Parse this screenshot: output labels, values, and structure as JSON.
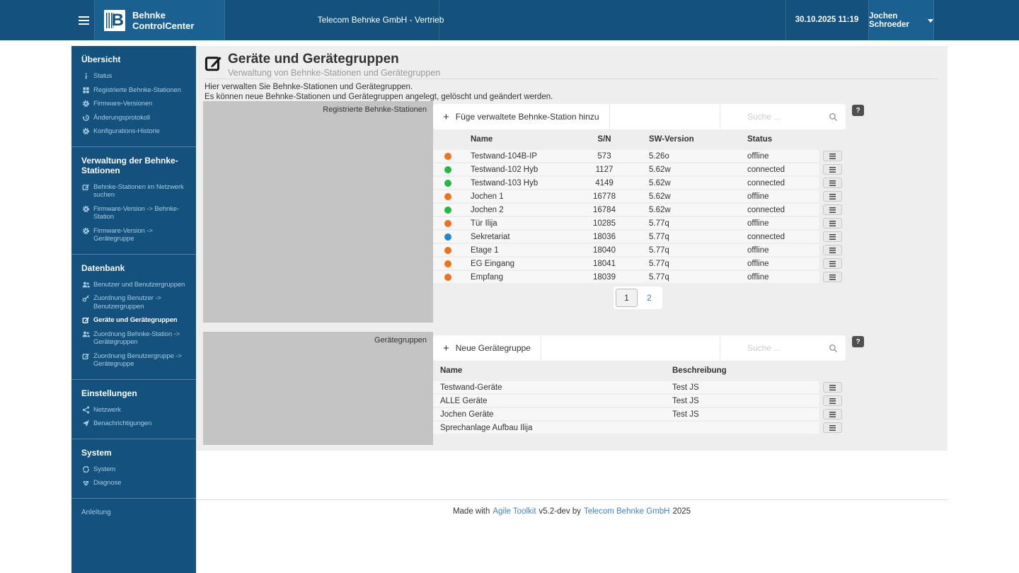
{
  "header": {
    "brand": "Behnke ControlCenter",
    "tenant": "Telecom Behnke GmbH - Vertrieb",
    "datetime": "30.10.2025 11:19",
    "user": "Jochen Schroeder"
  },
  "sidebar": {
    "sections": [
      {
        "title": "Übersicht",
        "items": [
          {
            "icon": "info-icon",
            "label": "Status"
          },
          {
            "icon": "stations-icon",
            "label": "Registrierte Behnke-Stationen"
          },
          {
            "icon": "gear-icon",
            "label": "Firmware-Versionen"
          },
          {
            "icon": "history-icon",
            "label": "Änderungsprotokoll"
          },
          {
            "icon": "gear-icon",
            "label": "Konfigurations-Historie"
          }
        ]
      },
      {
        "title": "Verwaltung der Behnke-Stationen",
        "items": [
          {
            "icon": "edit-icon",
            "label": "Behnke-Stationen im Netzwerk suchen"
          },
          {
            "icon": "gear-icon",
            "label": "Firmware-Version -> Behnke-Station"
          },
          {
            "icon": "gear-icon",
            "label": "Firmware-Version -> Gerätegruppe"
          }
        ]
      },
      {
        "title": "Datenbank",
        "items": [
          {
            "icon": "users-icon",
            "label": "Benutzer und Benutzergruppen"
          },
          {
            "icon": "key-icon",
            "label": "Zuordnung Benutzer -> Benutzergruppen"
          },
          {
            "icon": "edit-icon",
            "label": "Geräte und Gerätegruppen",
            "active": true
          },
          {
            "icon": "users-icon",
            "label": "Zuordnung Behnke-Station -> Gerätegruppen"
          },
          {
            "icon": "edit-icon",
            "label": "Zuordnung Benutzergruppe -> Gerätegruppe"
          }
        ]
      },
      {
        "title": "Einstellungen",
        "items": [
          {
            "icon": "share-icon",
            "label": "Netzwerk"
          },
          {
            "icon": "send-icon",
            "label": "Benachrichtigungen"
          }
        ]
      },
      {
        "title": "System",
        "items": [
          {
            "icon": "sync-icon",
            "label": "System"
          },
          {
            "icon": "heartbeat-icon",
            "label": "Diagnose"
          }
        ]
      }
    ],
    "footer_link": "Anleitung"
  },
  "page": {
    "title": "Geräte und Gerätegruppen",
    "subtitle": "Verwaltung von Behnke-Stationen und Gerätegruppen",
    "description_lines": [
      "Hier verwalten Sie Behnke-Stationen und Gerätegruppen.",
      "Es können neue Behnke-Stationen und Gerätegruppen angelegt, gelöscht und geändert werden."
    ]
  },
  "stations": {
    "image_label": "Registrierte Behnke-Stationen",
    "add_button": "Füge verwaltete Behnke-Station hinzu",
    "search_placeholder": "Suche ...",
    "help_label": "?",
    "columns": [
      "Name",
      "S/N",
      "SW-Version",
      "Status"
    ],
    "rows": [
      {
        "dot": "orange",
        "name": "Testwand-104B-IP",
        "sn": "573",
        "sw": "5.26o",
        "status": "offline"
      },
      {
        "dot": "green",
        "name": "Testwand-102 Hyb",
        "sn": "1127",
        "sw": "5.62w",
        "status": "connected"
      },
      {
        "dot": "green",
        "name": "Testwand-103 Hyb",
        "sn": "4149",
        "sw": "5.62w",
        "status": "connected"
      },
      {
        "dot": "orange",
        "name": "Jochen 1",
        "sn": "16778",
        "sw": "5.62w",
        "status": "offline"
      },
      {
        "dot": "green",
        "name": "Jochen 2",
        "sn": "16784",
        "sw": "5.62w",
        "status": "connected"
      },
      {
        "dot": "orange",
        "name": "Tür Ilija",
        "sn": "10285",
        "sw": "5.77q",
        "status": "offline"
      },
      {
        "dot": "blue",
        "name": "Sekretariat",
        "sn": "18036",
        "sw": "5.77q",
        "status": "connected"
      },
      {
        "dot": "orange",
        "name": "Etage 1",
        "sn": "18040",
        "sw": "5.77q",
        "status": "offline"
      },
      {
        "dot": "orange",
        "name": "EG Eingang",
        "sn": "18041",
        "sw": "5.77q",
        "status": "offline"
      },
      {
        "dot": "orange",
        "name": "Empfang",
        "sn": "18039",
        "sw": "5.77q",
        "status": "offline"
      }
    ],
    "pagination": [
      {
        "label": "1",
        "active": true
      },
      {
        "label": "2",
        "active": false
      }
    ]
  },
  "groups": {
    "image_label": "Gerätegruppen",
    "add_button": "Neue Gerätegruppe",
    "search_placeholder": "Suche ...",
    "help_label": "?",
    "columns": [
      "Name",
      "Beschreibung"
    ],
    "rows": [
      {
        "name": "Testwand-Geräte",
        "desc": "Test JS"
      },
      {
        "name": "ALLE Geräte",
        "desc": "Test JS"
      },
      {
        "name": "Jochen Geräte",
        "desc": "Test JS"
      },
      {
        "name": "Sprechanlage Aufbau Ilija",
        "desc": ""
      }
    ]
  },
  "footer": {
    "made_with": "Made with",
    "toolkit_link": "Agile Toolkit",
    "version_by": "v5.2-dev by",
    "company_link": "Telecom Behnke GmbH",
    "year": "2025"
  },
  "colors": {
    "header_bg": "#14527D",
    "header_bg_light": "#1A6090",
    "link_blue": "#4183C4",
    "dot_orange": "#F2711C",
    "dot_green": "#21BA45",
    "dot_blue": "#2185D0",
    "panel_bg": "#EEEEEE",
    "image_placeholder_bg": "#C3C3C3",
    "help_button_bg": "#4F4F4F"
  }
}
